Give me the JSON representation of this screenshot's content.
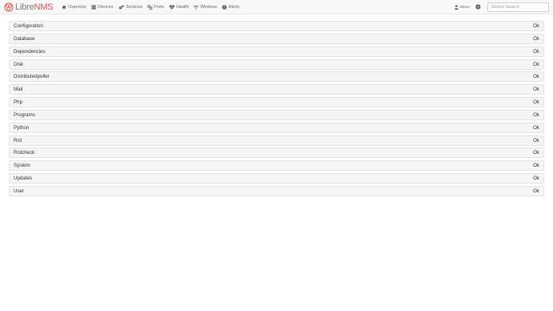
{
  "brand": {
    "libre": "Libre",
    "nms": "NMS"
  },
  "nav": {
    "overview": "Overview",
    "devices": "Devices",
    "services": "Services",
    "ports": "Ports",
    "health": "Health",
    "wireless": "Wireless",
    "alerts": "Alerts",
    "user_menu": "Menu"
  },
  "search": {
    "placeholder": "Global Search",
    "value": ""
  },
  "checks": [
    {
      "name": "Configuration",
      "status": "Ok"
    },
    {
      "name": "Database",
      "status": "Ok"
    },
    {
      "name": "Dependencies",
      "status": "Ok"
    },
    {
      "name": "Disk",
      "status": "Ok"
    },
    {
      "name": "Distributedpoller",
      "status": "Ok"
    },
    {
      "name": "Mail",
      "status": "Ok"
    },
    {
      "name": "Php",
      "status": "Ok"
    },
    {
      "name": "Programs",
      "status": "Ok"
    },
    {
      "name": "Python",
      "status": "Ok"
    },
    {
      "name": "Rrd",
      "status": "Ok"
    },
    {
      "name": "Rrdcheck",
      "status": "Ok"
    },
    {
      "name": "System",
      "status": "Ok"
    },
    {
      "name": "Updates",
      "status": "Ok"
    },
    {
      "name": "User",
      "status": "Ok"
    }
  ],
  "colors": {
    "brand_accent": "#d9534f",
    "brand_gray": "#7a7a7a",
    "row_bg": "#f5f5f5",
    "nav_bg": "#f8f8f8"
  },
  "icons": {
    "brand": "librenms-logo-icon",
    "overview": "home-icon",
    "devices": "server-icon",
    "services": "cogs-icon",
    "ports": "link-icon",
    "health": "heartbeat-icon",
    "wireless": "wifi-icon",
    "alerts": "exclamation-circle-icon",
    "user": "user-icon",
    "settings": "gear-icon"
  }
}
